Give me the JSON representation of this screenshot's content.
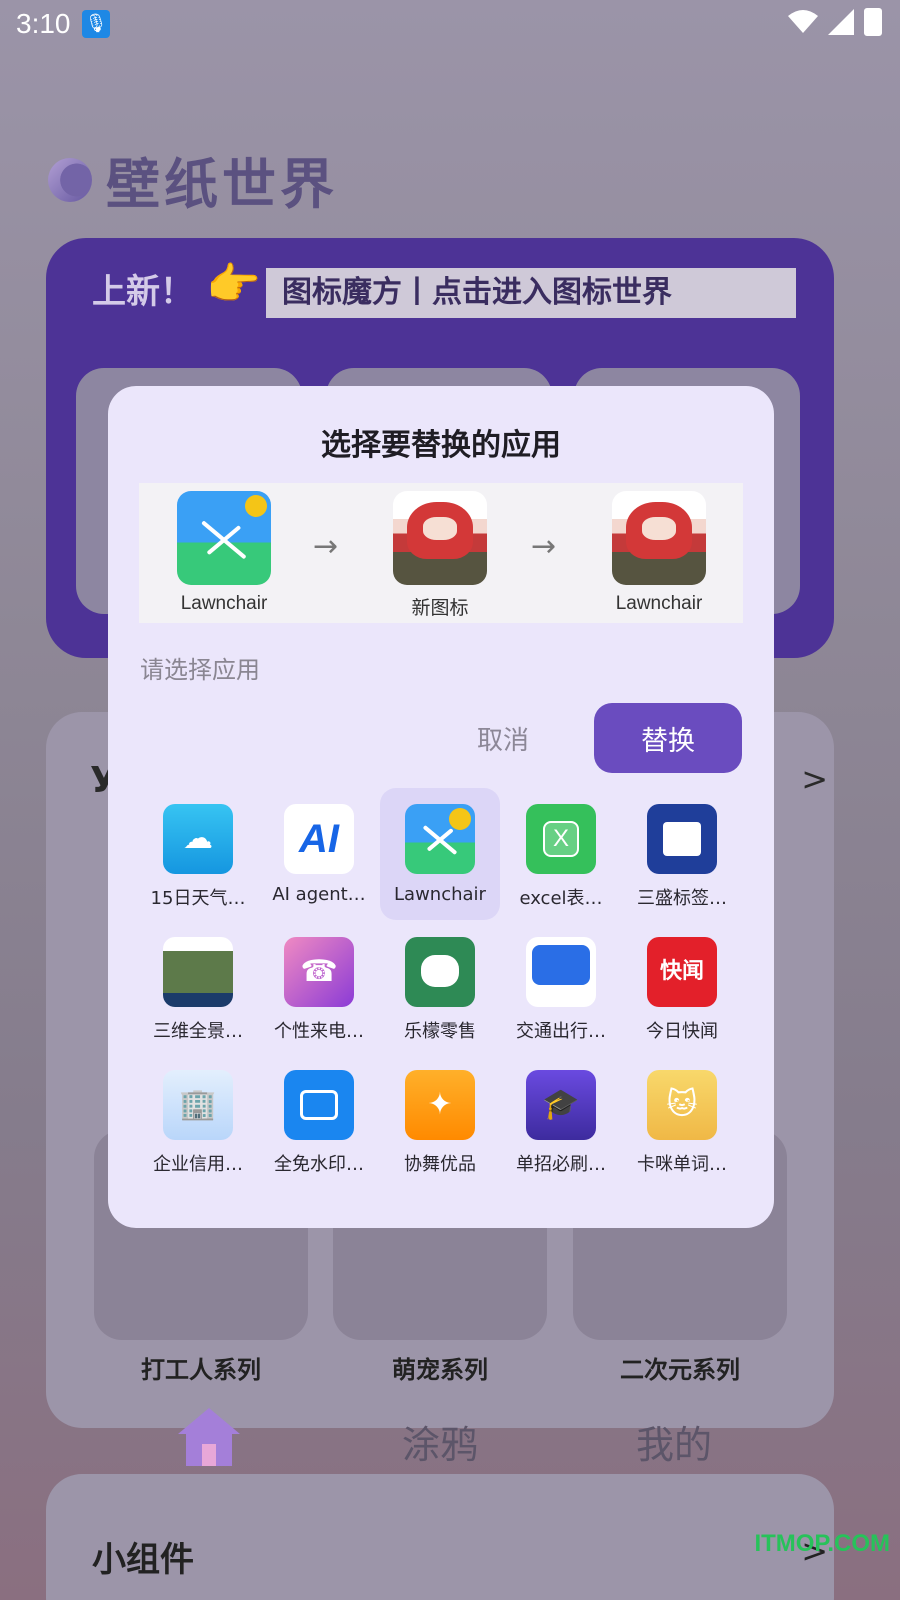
{
  "status_bar": {
    "time": "3:10"
  },
  "background": {
    "brand_title": "壁纸世界",
    "promo_tag": "上新！",
    "promo_banner": "图标魔方丨点击进入图标世界",
    "section_letter": "У",
    "section_more": ">",
    "series": [
      "打工人系列",
      "萌宠系列",
      "二次元系列"
    ],
    "nav": {
      "doodle": "涂鸦",
      "mine": "我的"
    },
    "widget_title": "小组件",
    "widget_more": ">",
    "watermark": "ITMOP.COM"
  },
  "dialog": {
    "title": "选择要替换的应用",
    "preview": {
      "source_label": "Lawnchair",
      "new_icon_label": "新图标",
      "result_label": "Lawnchair",
      "arrow": "→"
    },
    "hint": "请选择应用",
    "cancel_label": "取消",
    "replace_label": "替换",
    "apps": [
      {
        "label": "15日天气…",
        "icon": "weather-icon"
      },
      {
        "label": "AI agent…",
        "icon": "ai-agent-icon",
        "glyph": "AI"
      },
      {
        "label": "Lawnchair",
        "icon": "lawnchair-icon",
        "selected": true
      },
      {
        "label": "excel表…",
        "icon": "excel-icon",
        "glyph": "X"
      },
      {
        "label": "三盛标签…",
        "icon": "label-printer-icon"
      },
      {
        "label": "三维全景…",
        "icon": "panorama-map-icon"
      },
      {
        "label": "个性来电…",
        "icon": "ringtone-phone-icon"
      },
      {
        "label": "乐檬零售",
        "icon": "robot-retail-icon"
      },
      {
        "label": "交通出行…",
        "icon": "traffic-car-icon"
      },
      {
        "label": "今日快闻",
        "icon": "news-icon",
        "glyph": "快闻"
      },
      {
        "label": "企业信用…",
        "icon": "enterprise-credit-icon"
      },
      {
        "label": "全免水印…",
        "icon": "camera-watermark-icon"
      },
      {
        "label": "协舞优品",
        "icon": "dance-icon"
      },
      {
        "label": "单招必刷…",
        "icon": "exam-icon"
      },
      {
        "label": "卡咪单词…",
        "icon": "cat-words-icon"
      }
    ]
  },
  "colors": {
    "accent": "#6a4cbf",
    "dialog_bg": "#ebe6fb",
    "selected_bg": "#dcd6f7"
  }
}
